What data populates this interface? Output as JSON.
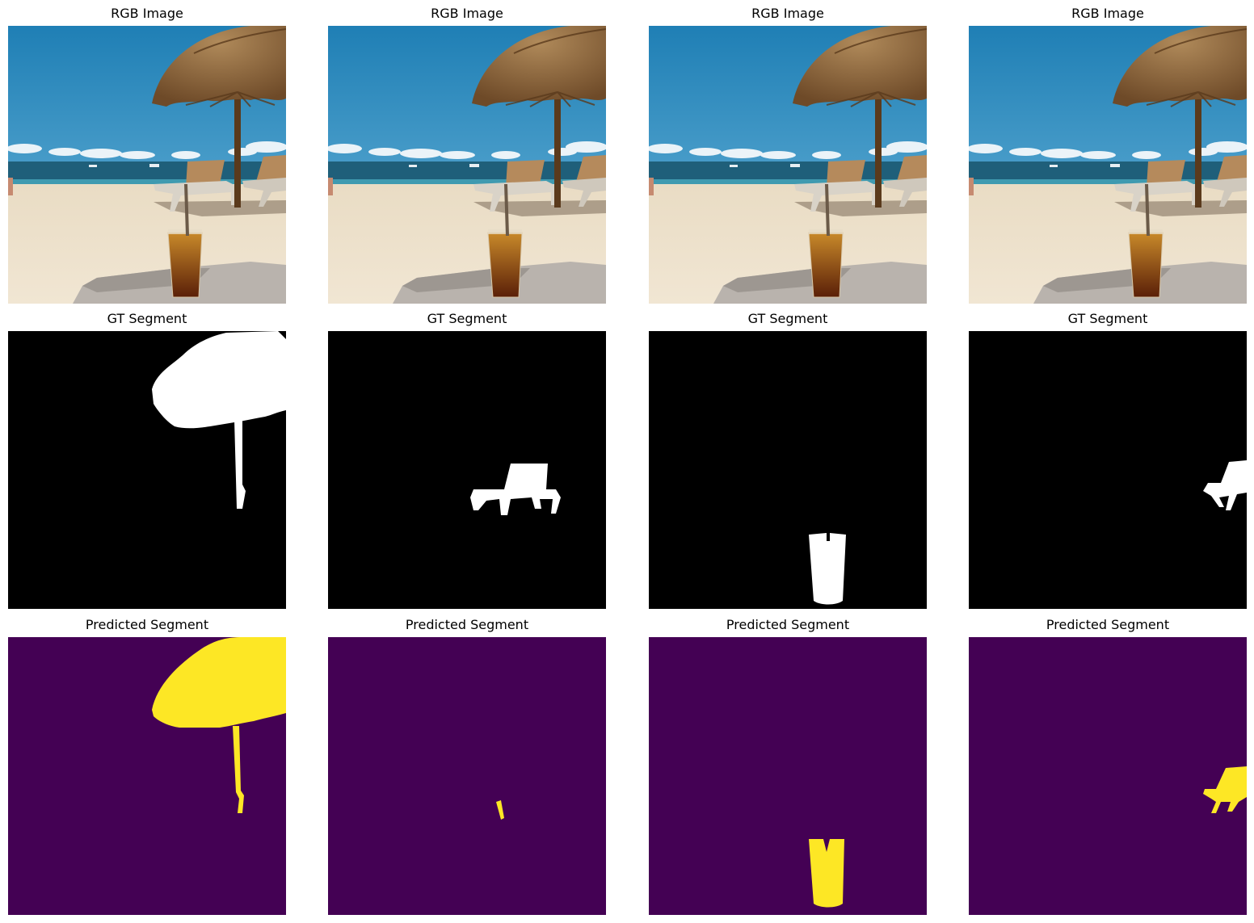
{
  "figure": {
    "rows": [
      {
        "titles": [
          "RGB Image",
          "RGB Image",
          "RGB Image",
          "RGB Image"
        ]
      },
      {
        "titles": [
          "GT Segment",
          "GT Segment",
          "GT Segment",
          "GT Segment"
        ]
      },
      {
        "titles": [
          "Predicted Segment",
          "Predicted Segment",
          "Predicted Segment",
          "Predicted Segment"
        ]
      }
    ],
    "columns": [
      {
        "target": "umbrella"
      },
      {
        "target": "beach-chair"
      },
      {
        "target": "drink-glass"
      },
      {
        "target": "chair-right-edge"
      }
    ]
  },
  "colors": {
    "gt_background": "#000000",
    "gt_foreground": "#ffffff",
    "pred_background": "#440154",
    "pred_foreground": "#fde725",
    "sky": "#2a86b8",
    "sea": "#1f5f7a",
    "sand": "#eadcc2",
    "thatch": "#8a6640",
    "drink": "#a05a10"
  }
}
